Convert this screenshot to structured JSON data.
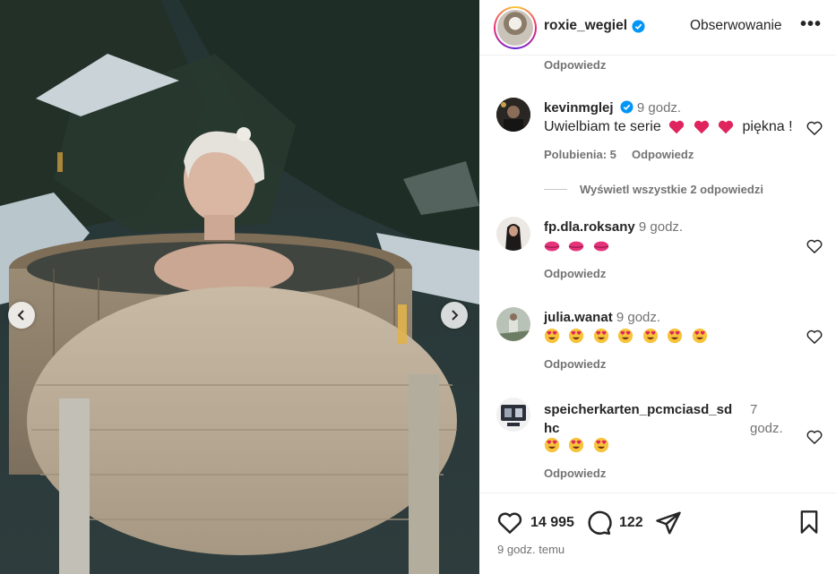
{
  "post": {
    "username": "roxie_wegiel",
    "follow_label": "Obserwowanie",
    "more_label": "•••"
  },
  "comments": {
    "top_reply_label": "Odpowiedz",
    "items": [
      {
        "username": "kevinmglej",
        "verified": true,
        "time": "9 godz.",
        "text": "Uwielbiam te serie",
        "text_suffix": "piękna !",
        "emoji": [
          "heart",
          "heart",
          "heart"
        ],
        "likes_label": "Polubienia: 5",
        "reply_label": "Odpowiedz"
      },
      {
        "username": "fp.dla.roksany",
        "time": "9 godz.",
        "emoji": [
          "kiss",
          "kiss",
          "kiss"
        ],
        "reply_label": "Odpowiedz"
      },
      {
        "username": "julia.wanat",
        "time": "9 godz.",
        "emoji": [
          "heart-eyes",
          "heart-eyes",
          "heart-eyes",
          "heart-eyes",
          "heart-eyes",
          "heart-eyes",
          "heart-eyes"
        ],
        "reply_label": "Odpowiedz"
      },
      {
        "username_line1": "speicherkarten_pcmciasd_sd",
        "username_line2": "hc",
        "time_line1": "7",
        "time_line2": "godz.",
        "emoji": [
          "heart-eyes",
          "heart-eyes",
          "heart-eyes"
        ],
        "reply_label": "Odpowiedz"
      }
    ],
    "view_replies_label": "Wyświetl wszystkie 2 odpowiedzi"
  },
  "actions": {
    "likes_count": "14 995",
    "comments_count": "122",
    "posted_time": "9 godz. temu"
  },
  "colors": {
    "verified_blue": "#0095f6",
    "heart_red": "#e0245e",
    "kiss_pink": "#e5337a"
  }
}
